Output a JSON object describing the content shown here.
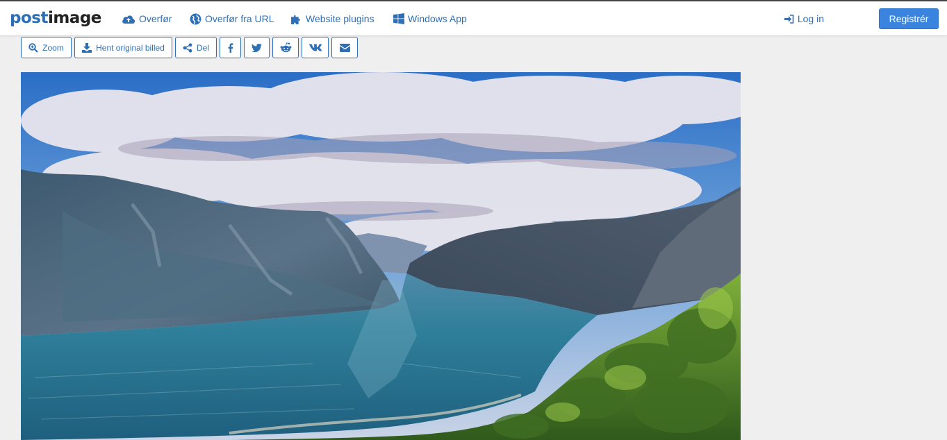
{
  "header": {
    "logo_part1": "post",
    "logo_part2": "image",
    "nav": [
      {
        "label": "Overfør",
        "icon": "cloud-upload-icon"
      },
      {
        "label": "Overfør fra URL",
        "icon": "globe-icon"
      },
      {
        "label": "Website plugins",
        "icon": "puzzle-piece-icon"
      },
      {
        "label": "Windows App",
        "icon": "windows-icon"
      }
    ],
    "login_label": "Log in",
    "register_label": "Registrér"
  },
  "toolbar": {
    "zoom_label": "Zoom",
    "download_label": "Hent original billed",
    "share_label": "Del",
    "social": [
      "facebook-icon",
      "twitter-icon",
      "reddit-icon",
      "vk-icon",
      "email-icon"
    ]
  },
  "colors": {
    "accent": "#2f6fb6",
    "register_button": "#3a84df",
    "background": "#efefef"
  }
}
